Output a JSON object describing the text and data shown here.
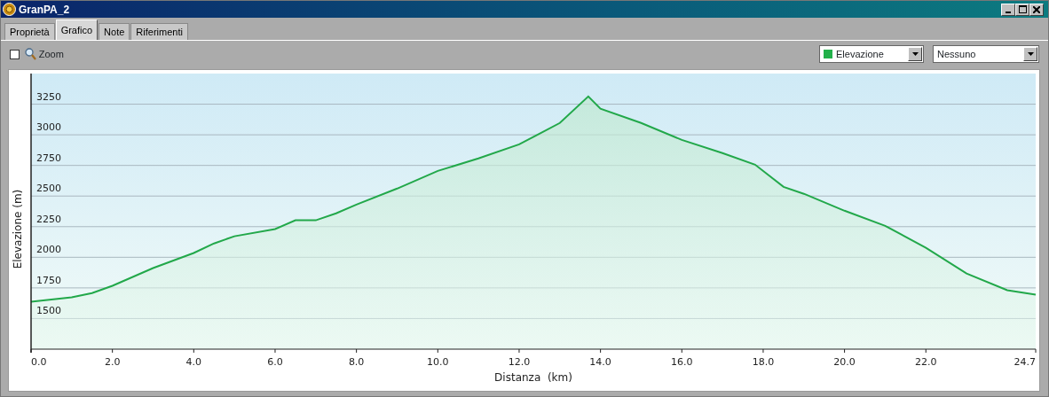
{
  "window": {
    "title": "GranPA_2"
  },
  "tabs": [
    {
      "label": "Proprietà",
      "selected": false
    },
    {
      "label": "Grafico",
      "selected": true
    },
    {
      "label": "Note",
      "selected": false
    },
    {
      "label": "Riferimenti",
      "selected": false
    }
  ],
  "zoom": {
    "label": "Zoom",
    "checked": false
  },
  "selectors": [
    {
      "value": "Elevazione",
      "color": "#22b04a"
    },
    {
      "value": "Nessuno"
    }
  ],
  "chart": {
    "chart_data": {
      "type": "area",
      "xlabel": "Distanza  (km)",
      "ylabel": "Elevazione (m)",
      "x": [
        0,
        1,
        1.5,
        2,
        3,
        4,
        4.5,
        5,
        6,
        6.5,
        7,
        7.5,
        8,
        9,
        10,
        11,
        12,
        12.5,
        13,
        13.7,
        14,
        15,
        16,
        17,
        17.8,
        18.5,
        19,
        20,
        21,
        22,
        23,
        24,
        24.7
      ],
      "grid": true,
      "series": [
        {
          "color": "#22a84a",
          "values": [
            1637,
            1673,
            1708,
            1767,
            1912,
            2035,
            2113,
            2172,
            2230,
            2302,
            2302,
            2359,
            2431,
            2561,
            2705,
            2807,
            2922,
            3009,
            3096,
            3313,
            3213,
            3096,
            2958,
            2850,
            2756,
            2575,
            2518,
            2380,
            2257,
            2077,
            1868,
            1731,
            1695
          ]
        }
      ],
      "xlim": [
        0,
        24.7
      ],
      "ylim": [
        1250,
        3500
      ],
      "xticks": [
        {
          "value": 0,
          "label": "0.0"
        },
        {
          "value": 2,
          "label": "2.0"
        },
        {
          "value": 4,
          "label": "4.0"
        },
        {
          "value": 6,
          "label": "6.0"
        },
        {
          "value": 8,
          "label": "8.0"
        },
        {
          "value": 10,
          "label": "10.0"
        },
        {
          "value": 12,
          "label": "12.0"
        },
        {
          "value": 14,
          "label": "14.0"
        },
        {
          "value": 16,
          "label": "16.0"
        },
        {
          "value": 18,
          "label": "18.0"
        },
        {
          "value": 20,
          "label": "20.0"
        },
        {
          "value": 22,
          "label": "22.0"
        },
        {
          "value": 24.7,
          "label": "24.7"
        }
      ],
      "yticks": [
        1500,
        1750,
        2000,
        2250,
        2500,
        2750,
        3000,
        3250
      ]
    }
  }
}
